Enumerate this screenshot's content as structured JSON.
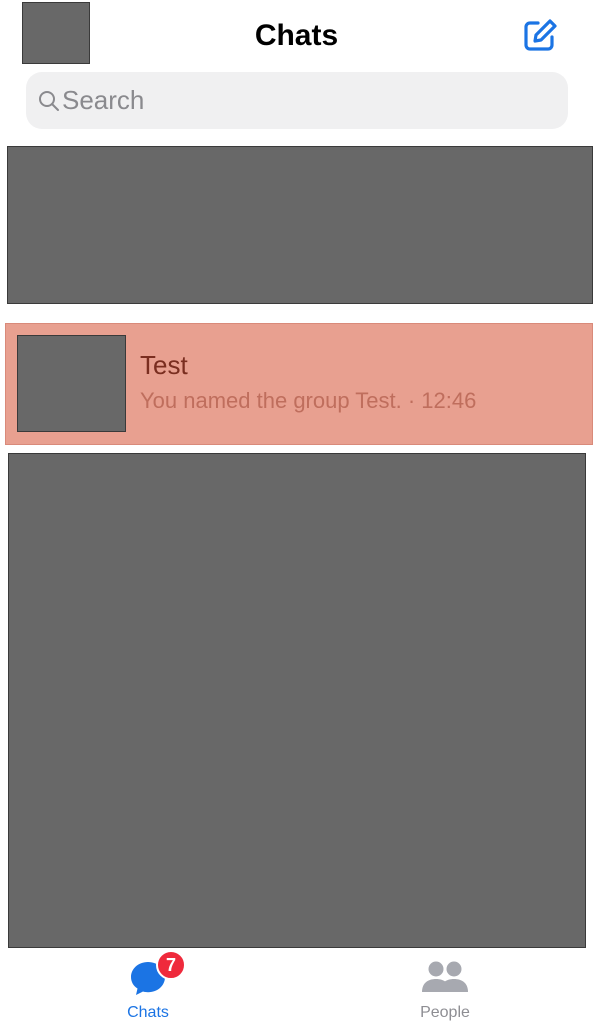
{
  "header": {
    "title": "Chats"
  },
  "search": {
    "placeholder": "Search"
  },
  "chats": [
    {
      "name": "Test",
      "preview": "You named the group Test. · 12:46"
    }
  ],
  "tab_bar": {
    "tabs": [
      {
        "label": "Chats",
        "badge": "7",
        "active": true
      },
      {
        "label": "People",
        "active": false
      }
    ]
  },
  "colors": {
    "accent": "#1b74e4",
    "badge": "#ef2a3c",
    "highlight_row": "#e8a090",
    "redacted": "#686868"
  },
  "icons": {
    "compose": "compose-icon",
    "search": "search-icon",
    "chats_tab": "chat-bubble-icon",
    "people_tab": "people-icon"
  }
}
